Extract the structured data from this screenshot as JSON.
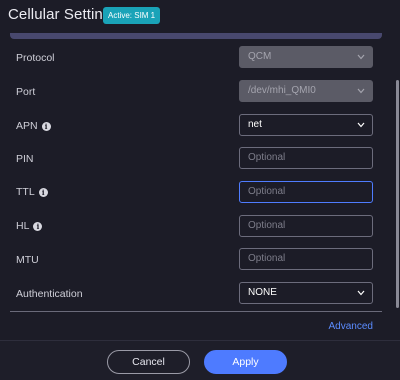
{
  "header": {
    "title": "Cellular Settings",
    "badge": "Active: SIM 1"
  },
  "fields": {
    "protocol": {
      "label": "Protocol",
      "value": "QCM"
    },
    "port": {
      "label": "Port",
      "value": "/dev/mhi_QMI0"
    },
    "apn": {
      "label": "APN",
      "value": "net"
    },
    "pin": {
      "label": "PIN",
      "placeholder": "Optional"
    },
    "ttl": {
      "label": "TTL",
      "placeholder": "Optional"
    },
    "hl": {
      "label": "HL",
      "placeholder": "Optional"
    },
    "mtu": {
      "label": "MTU",
      "placeholder": "Optional"
    },
    "authentication": {
      "label": "Authentication",
      "value": "NONE"
    }
  },
  "links": {
    "advanced": "Advanced"
  },
  "footer": {
    "cancel_label": "Cancel",
    "apply_label": "Apply"
  },
  "colors": {
    "background": "#1c1c27",
    "accent": "#4e7bff",
    "badge": "#1aa3b8"
  },
  "icons": {
    "info": "info-icon",
    "dropdown": "chevron-down-icon"
  }
}
